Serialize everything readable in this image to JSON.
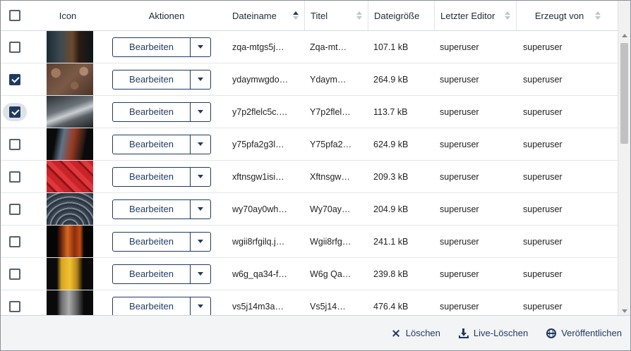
{
  "columns": {
    "select_all_checked": false,
    "icon": "Icon",
    "actions": "Aktionen",
    "filename": "Dateiname",
    "title": "Titel",
    "filesize": "Dateigröße",
    "last_editor": "Letzter Editor",
    "created_by": "Erzeugt von"
  },
  "rows": [
    {
      "checked": false,
      "thumb": "dark-corridor",
      "action_label": "Bearbeiten",
      "filename": "zqa-mtgs5j…",
      "title": "Zqa-mt…",
      "filesize": "107.1 kB",
      "editor": "superuser",
      "creator": "superuser"
    },
    {
      "checked": true,
      "thumb": "coffee-beans",
      "action_label": "Bearbeiten",
      "filename": "ydaymwgdo…",
      "title": "Ydaym…",
      "filesize": "264.9 kB",
      "editor": "superuser",
      "creator": "superuser"
    },
    {
      "checked": true,
      "thumb": "grey-curve",
      "action_label": "Bearbeiten",
      "filename": "y7p2flelc5c.…",
      "title": "Y7p2flel…",
      "filesize": "113.7 kB",
      "editor": "superuser",
      "creator": "superuser"
    },
    {
      "checked": false,
      "thumb": "red-blue-rock",
      "action_label": "Bearbeiten",
      "filename": "y75pfa2g3l…",
      "title": "Y75pfa2…",
      "filesize": "624.9 kB",
      "editor": "superuser",
      "creator": "superuser"
    },
    {
      "checked": false,
      "thumb": "red-blocks",
      "action_label": "Bearbeiten",
      "filename": "xftnsgw1isi…",
      "title": "Xftnsgw…",
      "filesize": "209.3 kB",
      "editor": "superuser",
      "creator": "superuser"
    },
    {
      "checked": false,
      "thumb": "metal-rings",
      "action_label": "Bearbeiten",
      "filename": "wy70ay0wh…",
      "title": "Wy70ay…",
      "filesize": "204.9 kB",
      "editor": "superuser",
      "creator": "superuser"
    },
    {
      "checked": false,
      "thumb": "embers",
      "action_label": "Bearbeiten",
      "filename": "wgii8rfgilq.j…",
      "title": "Wgii8rfg…",
      "filesize": "241.1 kB",
      "editor": "superuser",
      "creator": "superuser"
    },
    {
      "checked": false,
      "thumb": "yellow-pattern",
      "action_label": "Bearbeiten",
      "filename": "w6g_qa34-f…",
      "title": "W6g Qa…",
      "filesize": "239.8 kB",
      "editor": "superuser",
      "creator": "superuser"
    },
    {
      "checked": false,
      "thumb": "grey-stone",
      "action_label": "Bearbeiten",
      "filename": "vs5j14m3a…",
      "title": "Vs5j14…",
      "filesize": "476.4 kB",
      "editor": "superuser",
      "creator": "superuser"
    }
  ],
  "footer": {
    "delete": "Löschen",
    "live_delete": "Live-Löschen",
    "publish": "Veröffentlichen"
  },
  "colors": {
    "accent": "#1f3a5f",
    "header_border": "#d5d9de",
    "footer_bg": "#f3f4f6"
  }
}
